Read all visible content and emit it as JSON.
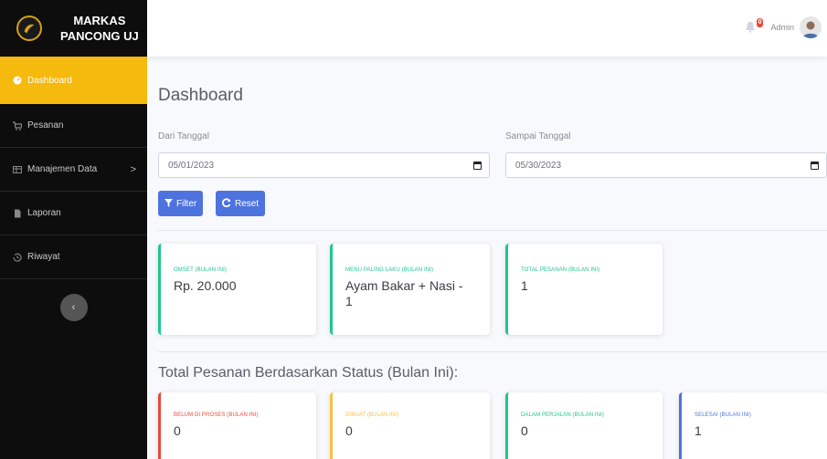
{
  "brand": {
    "line1": "MARKAS",
    "line2": "PANCONG UJ"
  },
  "sidebar": {
    "items": [
      {
        "label": "Dashboard",
        "icon": "tachometer-icon",
        "active": true
      },
      {
        "label": "Pesanan",
        "icon": "cart-icon"
      },
      {
        "label": "Manajemen Data",
        "icon": "table-icon",
        "chevron": ">"
      },
      {
        "label": "Laporan",
        "icon": "file-icon"
      },
      {
        "label": "Riwayat",
        "icon": "history-icon"
      }
    ],
    "toggle": "‹"
  },
  "topbar": {
    "badge": "0",
    "user": "Admin"
  },
  "page": {
    "title": "Dashboard"
  },
  "filter": {
    "from_label": "Dari Tanggal",
    "from_value": "05/01/2023",
    "to_label": "Sampai Tanggal",
    "to_value": "05/30/2023",
    "filter_btn": "Filter",
    "reset_btn": "Reset"
  },
  "summary": [
    {
      "title": "OMSET (BULAN INI)",
      "value": "Rp. 20.000"
    },
    {
      "title": "MENU PALING LAKU (BULAN INI)",
      "value": "Ayam Bakar + Nasi - 1"
    },
    {
      "title": "TOTAL PESANAN (BULAN INI)",
      "value": "1"
    }
  ],
  "status_section": {
    "title": "Total Pesanan Berdasarkan Status (Bulan Ini):"
  },
  "status": [
    {
      "title": "BELUM DI PROSES (BULAN INI)",
      "value": "0",
      "color": "#e74a3b"
    },
    {
      "title": "DIBUAT (BULAN INI)",
      "value": "0",
      "color": "#f6c23e"
    },
    {
      "title": "DALAM PERJALAN (BULAN INI)",
      "value": "0",
      "color": "#1cc88a"
    },
    {
      "title": "SELESAI (BULAN INI)",
      "value": "1",
      "color": "#4e73df"
    }
  ],
  "colors": {
    "accent": "#f6b90e",
    "primary": "#4e73df",
    "success": "#1cc88a"
  }
}
